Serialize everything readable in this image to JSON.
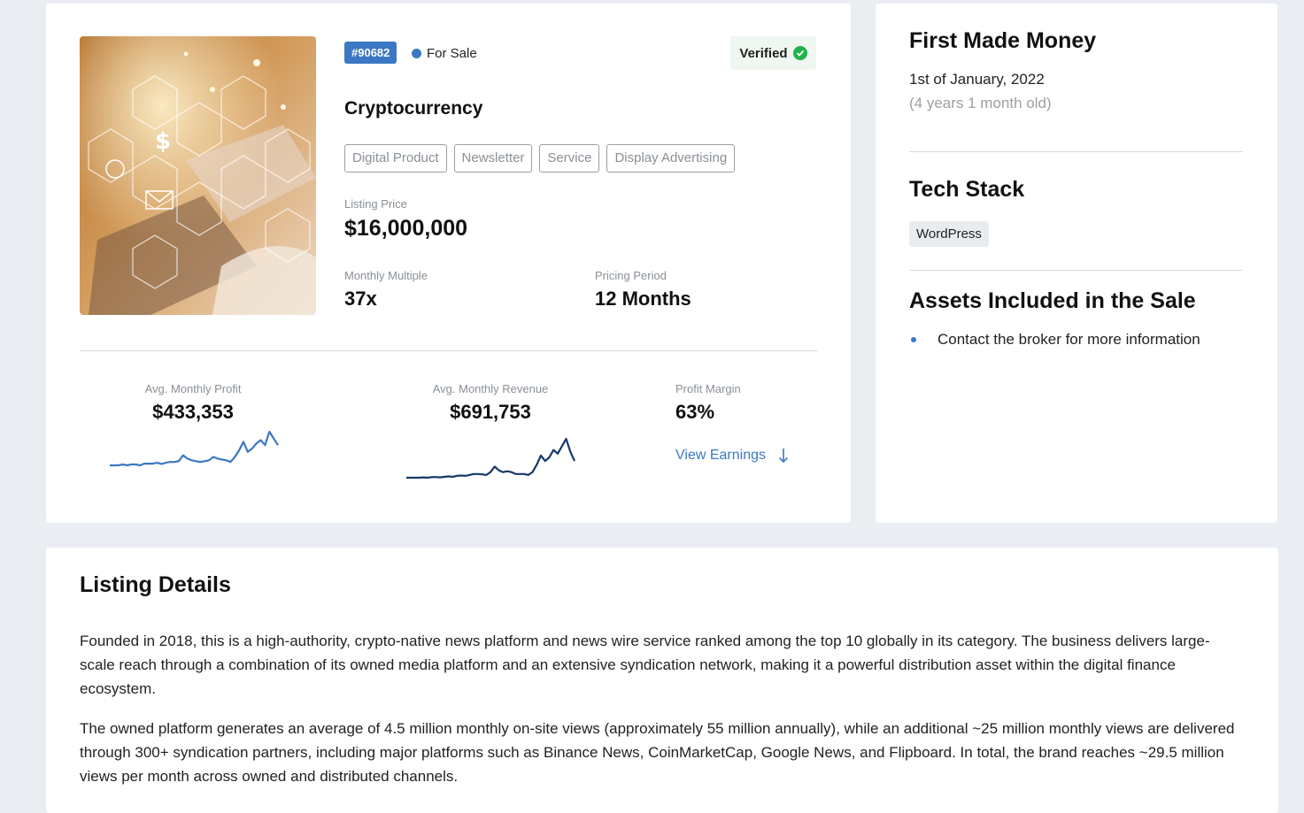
{
  "listing": {
    "id_badge": "#90682",
    "status": "For Sale",
    "verified_label": "Verified",
    "title": "Cryptocurrency",
    "tags": [
      "Digital Product",
      "Newsletter",
      "Service",
      "Display Advertising"
    ],
    "listing_price_label": "Listing Price",
    "listing_price": "$16,000,000",
    "monthly_multiple_label": "Monthly Multiple",
    "monthly_multiple": "37x",
    "pricing_period_label": "Pricing Period",
    "pricing_period": "12 Months"
  },
  "stats": {
    "profit_label": "Avg. Monthly Profit",
    "profit_value": "$433,353",
    "revenue_label": "Avg. Monthly Revenue",
    "revenue_value": "$691,753",
    "margin_label": "Profit Margin",
    "margin_value": "63%",
    "view_earnings": "View Earnings"
  },
  "sparklines": {
    "profit": {
      "color": "#3a78c3",
      "values": [
        10,
        10,
        10,
        10.5,
        10,
        10.5,
        10.5,
        10,
        11,
        11,
        11,
        11.5,
        10.8,
        11.5,
        12,
        12,
        12.5,
        16,
        14,
        13,
        12.5,
        12,
        12.5,
        13,
        15,
        14,
        13.5,
        13,
        12,
        15,
        19,
        24,
        18,
        20,
        23,
        25,
        22,
        30,
        26,
        22
      ]
    },
    "revenue": {
      "color": "#17386b",
      "values": [
        8,
        8,
        8,
        8,
        8.2,
        8,
        8.3,
        8.4,
        8.2,
        8.5,
        8.7,
        8.5,
        9,
        9.2,
        9,
        9.5,
        10,
        10,
        9.8,
        9.5,
        11,
        14,
        12,
        11,
        11.5,
        11,
        10,
        10,
        10,
        9.5,
        11,
        15,
        20,
        17,
        19,
        23,
        21,
        25,
        29,
        22,
        17
      ]
    }
  },
  "colors": {
    "accent": "#3a78c3",
    "verified_green": "#22b24c"
  },
  "sidebar": {
    "first_made_money_heading": "First Made Money",
    "first_made_money_date": "1st of January, 2022",
    "first_made_money_age": "(4 years 1 month old)",
    "tech_stack_heading": "Tech Stack",
    "tech_stack_items": [
      "WordPress"
    ],
    "assets_heading": "Assets Included in the Sale",
    "assets_items": [
      "Contact the broker for more information"
    ]
  },
  "details": {
    "heading": "Listing Details",
    "paragraphs": [
      "Founded in 2018, this is a high-authority, crypto-native news platform and news wire service ranked among the top 10 globally in its category. The business delivers large-scale reach through a combination of its owned media platform and an extensive syndication network, making it a powerful distribution asset within the digital finance ecosystem.",
      "The owned platform generates an average of 4.5 million monthly on-site views (approximately 55 million annually), while an additional ~25 million monthly views are delivered through 300+ syndication partners, including major platforms such as Binance News, CoinMarketCap, Google News, and Flipboard. In total, the brand reaches ~29.5 million views per month across owned and distributed channels."
    ]
  }
}
